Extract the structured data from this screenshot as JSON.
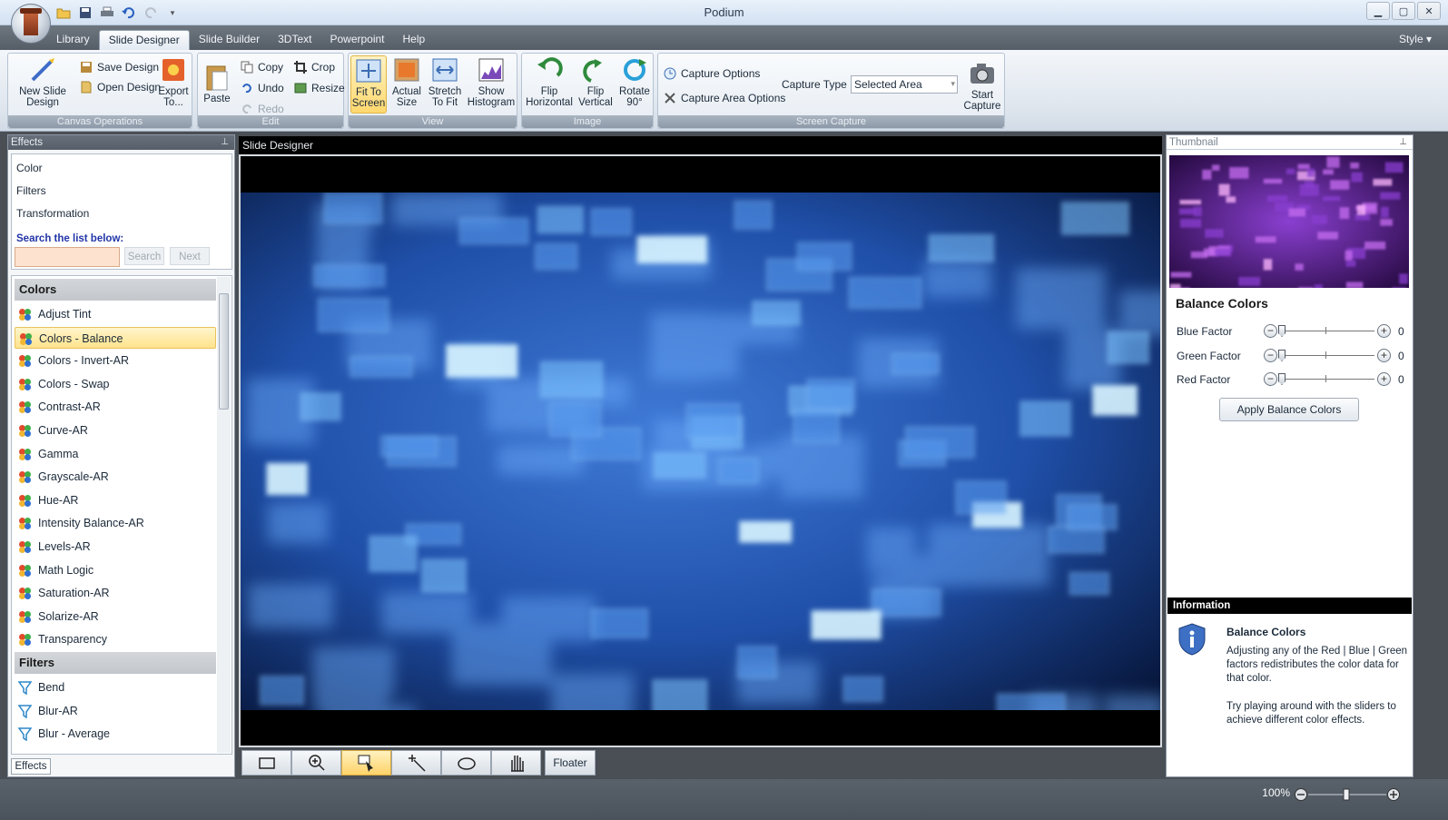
{
  "window": {
    "title": "Podium"
  },
  "tabs": [
    "Library",
    "Slide Designer",
    "Slide Builder",
    "3DText",
    "Powerpoint",
    "Help"
  ],
  "style_menu": "Style",
  "ribbon": {
    "canvas_operations": {
      "label": "Canvas Operations",
      "new": "New Slide Design",
      "save": "Save Design",
      "open": "Open Design",
      "export": "Export To..."
    },
    "edit": {
      "label": "Edit",
      "paste": "Paste",
      "copy": "Copy",
      "undo": "Undo",
      "redo": "Redo",
      "crop": "Crop",
      "resize": "Resize"
    },
    "view": {
      "label": "View",
      "fit": "Fit To Screen",
      "actual": "Actual Size",
      "stretch": "Stretch To Fit",
      "histogram": "Show Histogram"
    },
    "image": {
      "label": "Image",
      "flip_h": "Flip Horizontal",
      "flip_v": "Flip Vertical",
      "rotate": "Rotate 90°"
    },
    "screen_capture": {
      "label": "Screen Capture",
      "options": "Capture Options",
      "area_options": "Capture Area Options",
      "type_label": "Capture Type",
      "type_value": "Selected Area",
      "start": "Start Capture"
    }
  },
  "effects_panel": {
    "title": "Effects",
    "categories": [
      "Color",
      "Filters",
      "Transformation"
    ],
    "search_label": "Search the list below:",
    "search_value": "",
    "search_btn": "Search",
    "next_btn": "Next",
    "sections": [
      {
        "title": "Colors",
        "items": [
          "Adjust Tint",
          "Colors - Balance",
          "Colors - Invert-AR",
          "Colors - Swap",
          "Contrast-AR",
          "Curve-AR",
          "Gamma",
          "Grayscale-AR",
          "Hue-AR",
          "Intensity Balance-AR",
          "Levels-AR",
          "Math Logic",
          "Saturation-AR",
          "Solarize-AR",
          "Transparency"
        ]
      },
      {
        "title": "Filters",
        "items": [
          "Bend",
          "Blur-AR",
          "Blur - Average"
        ]
      }
    ],
    "selected_item": "Colors - Balance",
    "bottom_tab": "Effects"
  },
  "designer": {
    "title": "Slide Designer",
    "floater": "Floater"
  },
  "thumbnail_panel": {
    "title": "Thumbnail",
    "effect_title": "Balance Colors",
    "sliders": [
      {
        "label": "Blue Factor",
        "value": "0"
      },
      {
        "label": "Green Factor",
        "value": "0"
      },
      {
        "label": "Red Factor",
        "value": "0"
      }
    ],
    "apply": "Apply Balance Colors"
  },
  "information": {
    "header": "Information",
    "title": "Balance Colors",
    "body1": "Adjusting any of the Red | Blue | Green factors redistributes the color data for that color.",
    "body2": "Try playing around with the sliders to achieve different color effects."
  },
  "status": {
    "zoom": "100%"
  }
}
